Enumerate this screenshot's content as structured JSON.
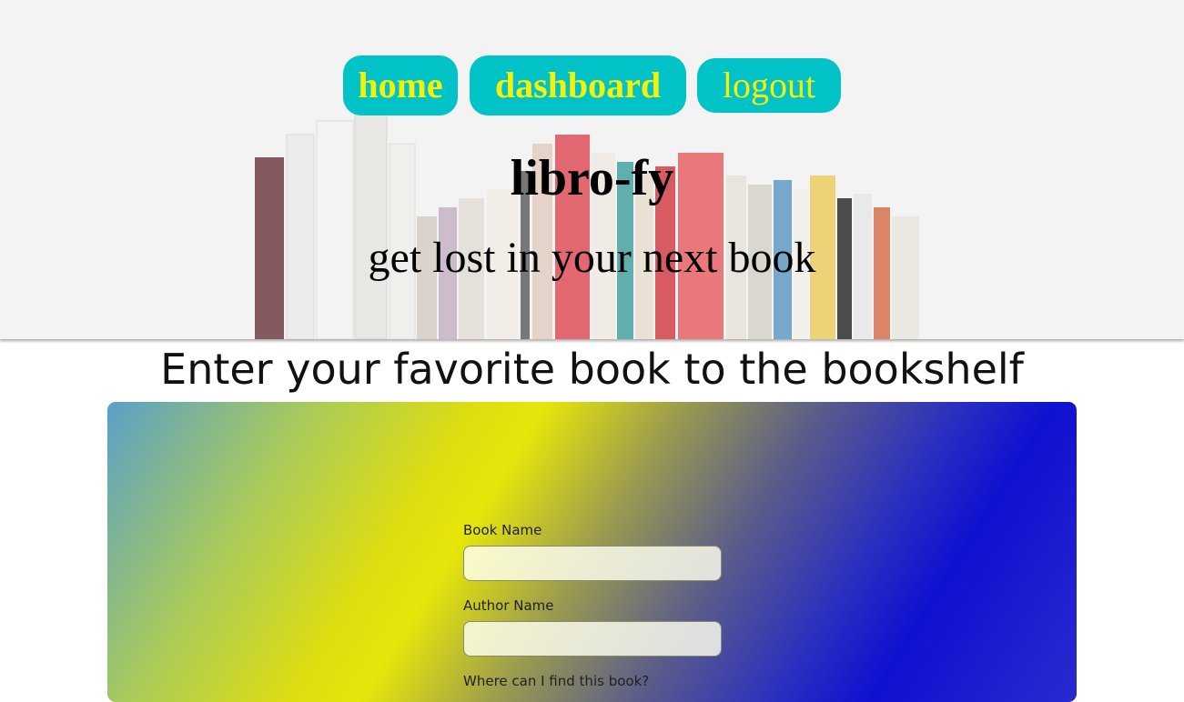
{
  "nav": {
    "home_label": "home",
    "dashboard_label": "dashboard",
    "logout_label": "logout"
  },
  "hero": {
    "title": "libro-fy",
    "tagline": "get lost in your next book"
  },
  "section": {
    "heading": "Enter your favorite book to the bookshelf"
  },
  "form": {
    "book_name_label": "Book Name",
    "book_name_value": "",
    "author_name_label": "Author Name",
    "author_name_value": "",
    "location_label": "Where can I find this book?"
  },
  "colors": {
    "nav_button_bg": "#00c2c7",
    "nav_button_text": "#f2f20a"
  }
}
